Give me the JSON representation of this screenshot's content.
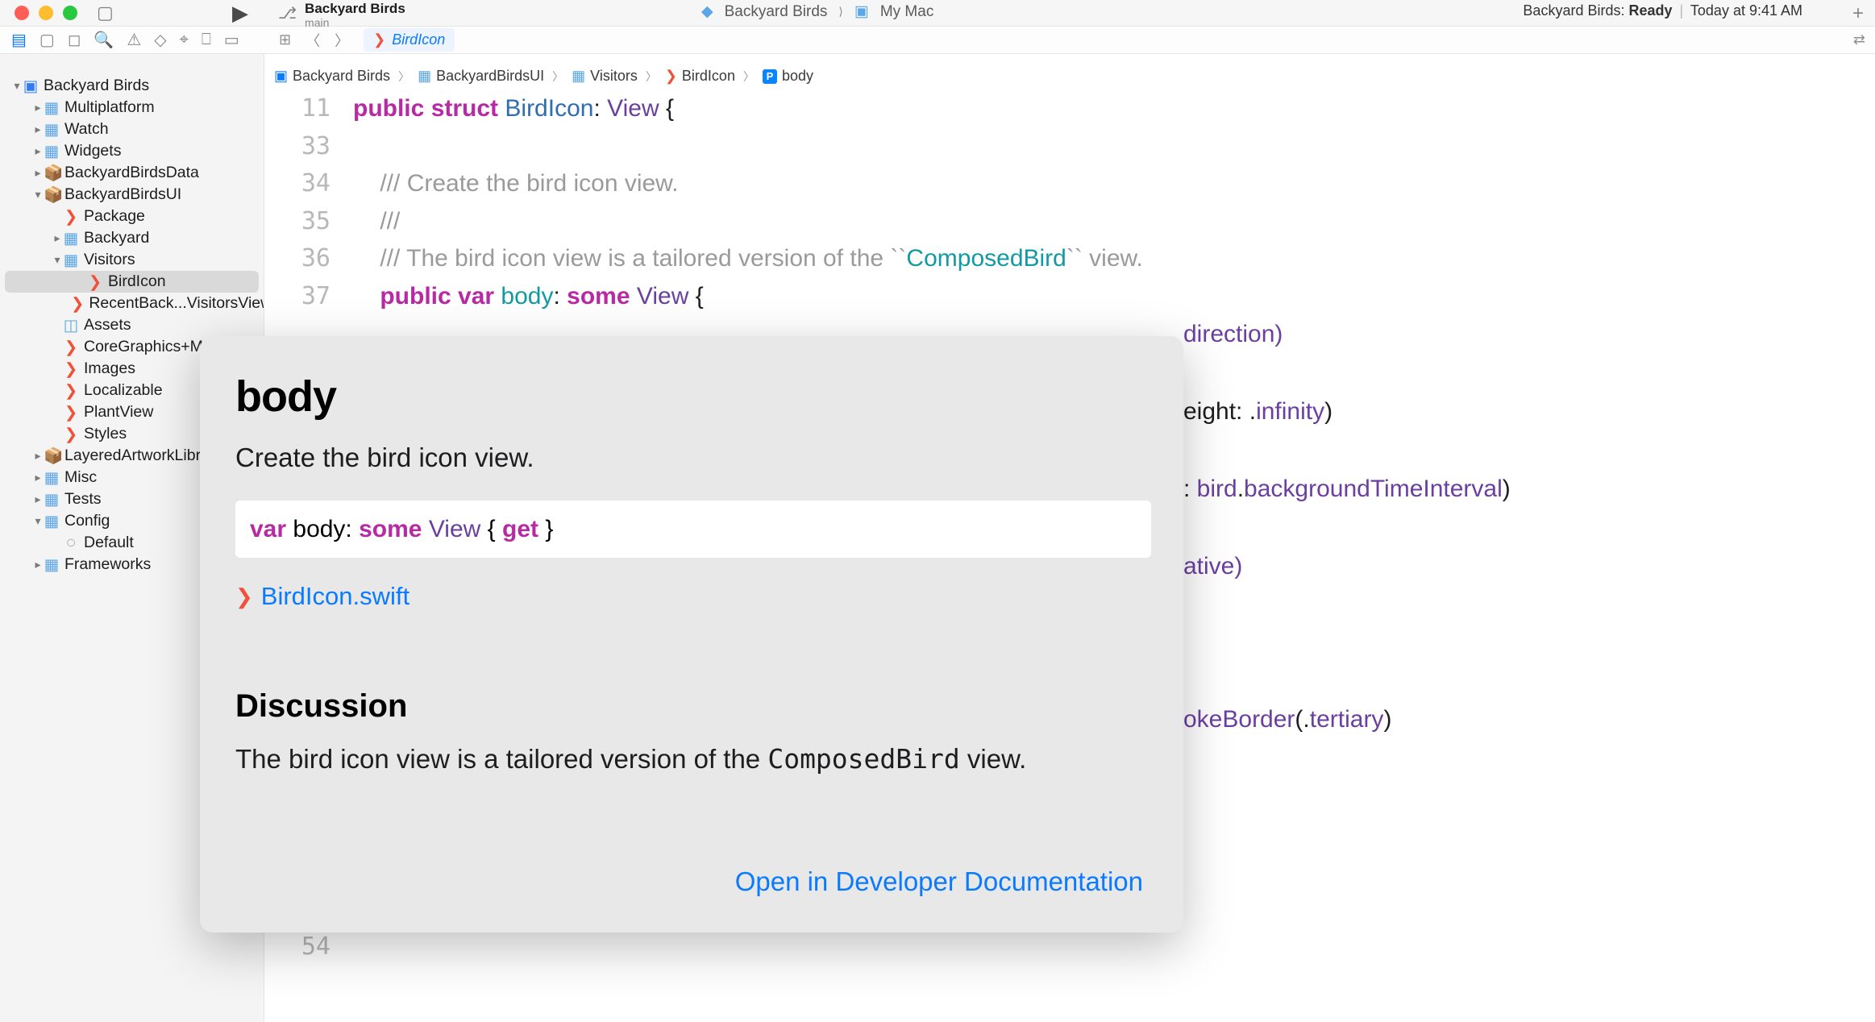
{
  "titlebar": {
    "project_name": "Backyard Birds",
    "branch": "main",
    "scheme_target": "Backyard Birds",
    "scheme_chevron": "⟩",
    "scheme_device": "My Mac",
    "status_prefix": "Backyard Birds:",
    "status_word": "Ready",
    "status_time": "Today at 9:41 AM"
  },
  "tab": {
    "filename": "BirdIcon"
  },
  "breadcrumb": {
    "b0": "Backyard Birds",
    "b1": "BackyardBirdsUI",
    "b2": "Visitors",
    "b3": "BirdIcon",
    "b4": "body"
  },
  "sidebar": {
    "root": "Backyard Birds",
    "n_multiplatform": "Multiplatform",
    "n_watch": "Watch",
    "n_widgets": "Widgets",
    "n_bbdata": "BackyardBirdsData",
    "n_bbui": "BackyardBirdsUI",
    "n_package": "Package",
    "n_backyard": "Backyard",
    "n_visitors": "Visitors",
    "n_birdicon": "BirdIcon",
    "n_recent": "RecentBack...VisitorsView",
    "n_assets": "Assets",
    "n_cg": "CoreGraphics+Math",
    "n_images": "Images",
    "n_local": "Localizable",
    "n_plant": "PlantView",
    "n_styles": "Styles",
    "n_lal": "LayeredArtworkLibrary",
    "n_misc": "Misc",
    "n_tests": "Tests",
    "n_config": "Config",
    "n_default": "Default",
    "n_frameworks": "Frameworks"
  },
  "code": {
    "ln11": "11",
    "ln33": "33",
    "ln34": "34",
    "ln35": "35",
    "ln36": "36",
    "ln37": "37",
    "ln54": "54",
    "l11_kw1": "public",
    "l11_kw2": "struct",
    "l11_name": "BirdIcon",
    "l11_colon": ": ",
    "l11_type": "View",
    "l11_brace": " {",
    "l34_a": "    /// ",
    "l34_b": "Create the bird icon view.",
    "l35": "    ///",
    "l36_a": "    /// ",
    "l36_b": "The bird icon view is a tailored version of the ``",
    "l36_c": "ComposedBird",
    "l36_d": "`` view.",
    "l37_a": "    ",
    "l37_kw1": "public",
    "l37_sp": " ",
    "l37_kw2": "var",
    "l37_sp2": " ",
    "l37_name": "body",
    "l37_colon": ": ",
    "l37_kw3": "some",
    "l37_sp3": " ",
    "l37_type": "View",
    "l37_brace": " {",
    "frag_direction": "direction)",
    "frag_height": "eight: .infinity)",
    "frag_bgtime": ": bird.backgroundTimeInterval)",
    "frag_ative": "ative)",
    "frag_stroke": "okeBorder(.tertiary)"
  },
  "popover": {
    "title": "body",
    "summary": "Create the bird icon view.",
    "decl_var": "var",
    "decl_body": " body: ",
    "decl_some": "some",
    "decl_view": " View ",
    "decl_brace_open": "{ ",
    "decl_get": "get",
    "decl_brace_close": " }",
    "file": "BirdIcon.swift",
    "discussion_h": "Discussion",
    "discussion_a": "The bird icon view is a tailored version of the ",
    "discussion_code": "ComposedBird",
    "discussion_b": " view.",
    "open_link": "Open in Developer Documentation"
  }
}
